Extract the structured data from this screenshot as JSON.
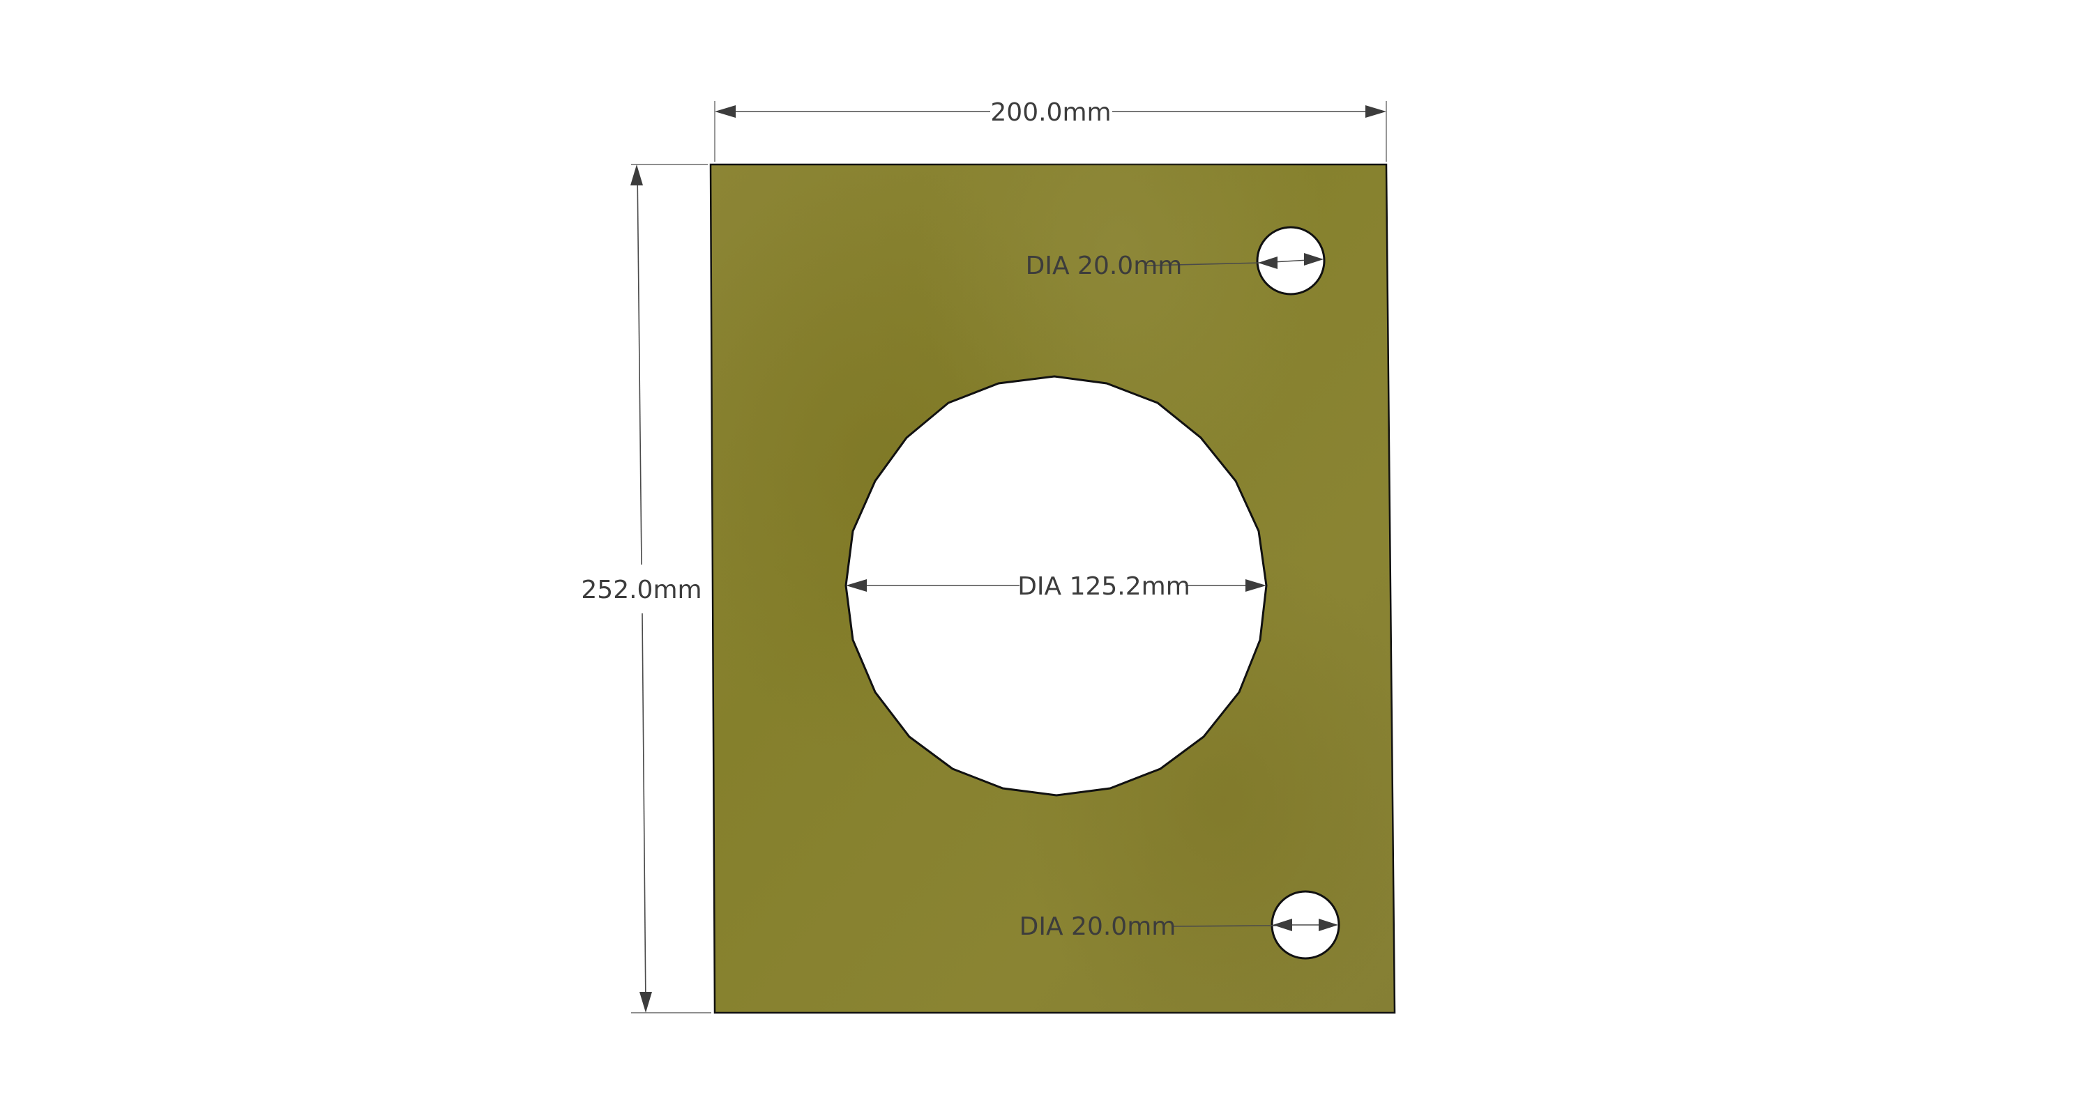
{
  "diagram": {
    "plate": {
      "fill_color": "#8a8231"
    },
    "dimensions": {
      "width_label": "200.0mm",
      "height_label": "252.0mm",
      "center_hole_label": "DIA 125.2mm",
      "top_hole_label": "DIA 20.0mm",
      "bottom_hole_label": "DIA 20.0mm"
    },
    "colors": {
      "dimension_text": "#3c3c3c",
      "hole_fill": "#ffffff",
      "outline": "#111111"
    }
  }
}
